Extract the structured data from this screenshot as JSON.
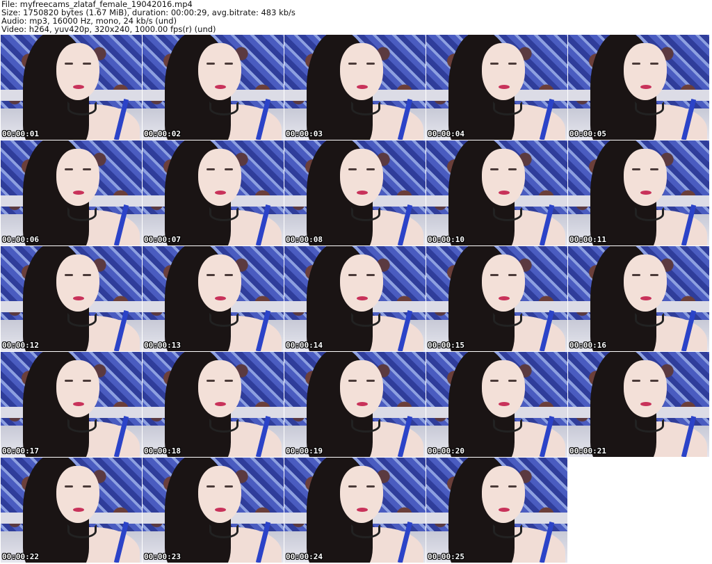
{
  "header": {
    "file": "File: myfreecams_zlataf_female_19042016.mp4",
    "size": "Size: 1750820 bytes (1.67 MiB), duration: 00:00:29, avg.bitrate: 483 kb/s",
    "audio": "Audio: mp3, 16000 Hz, mono, 24 kb/s (und)",
    "video": "Video: h264, yuv420p, 320x240, 1000.00 fps(r) (und)"
  },
  "thumbnails": [
    {
      "timestamp": "00:00:01"
    },
    {
      "timestamp": "00:00:02"
    },
    {
      "timestamp": "00:00:03"
    },
    {
      "timestamp": "00:00:04"
    },
    {
      "timestamp": "00:00:05"
    },
    {
      "timestamp": "00:00:06"
    },
    {
      "timestamp": "00:00:07"
    },
    {
      "timestamp": "00:00:08"
    },
    {
      "timestamp": "00:00:10"
    },
    {
      "timestamp": "00:00:11"
    },
    {
      "timestamp": "00:00:12"
    },
    {
      "timestamp": "00:00:13"
    },
    {
      "timestamp": "00:00:14"
    },
    {
      "timestamp": "00:00:15"
    },
    {
      "timestamp": "00:00:16"
    },
    {
      "timestamp": "00:00:17"
    },
    {
      "timestamp": "00:00:18"
    },
    {
      "timestamp": "00:00:19"
    },
    {
      "timestamp": "00:00:20"
    },
    {
      "timestamp": "00:00:21"
    },
    {
      "timestamp": "00:00:22"
    },
    {
      "timestamp": "00:00:23"
    },
    {
      "timestamp": "00:00:24"
    },
    {
      "timestamp": "00:00:25"
    }
  ]
}
